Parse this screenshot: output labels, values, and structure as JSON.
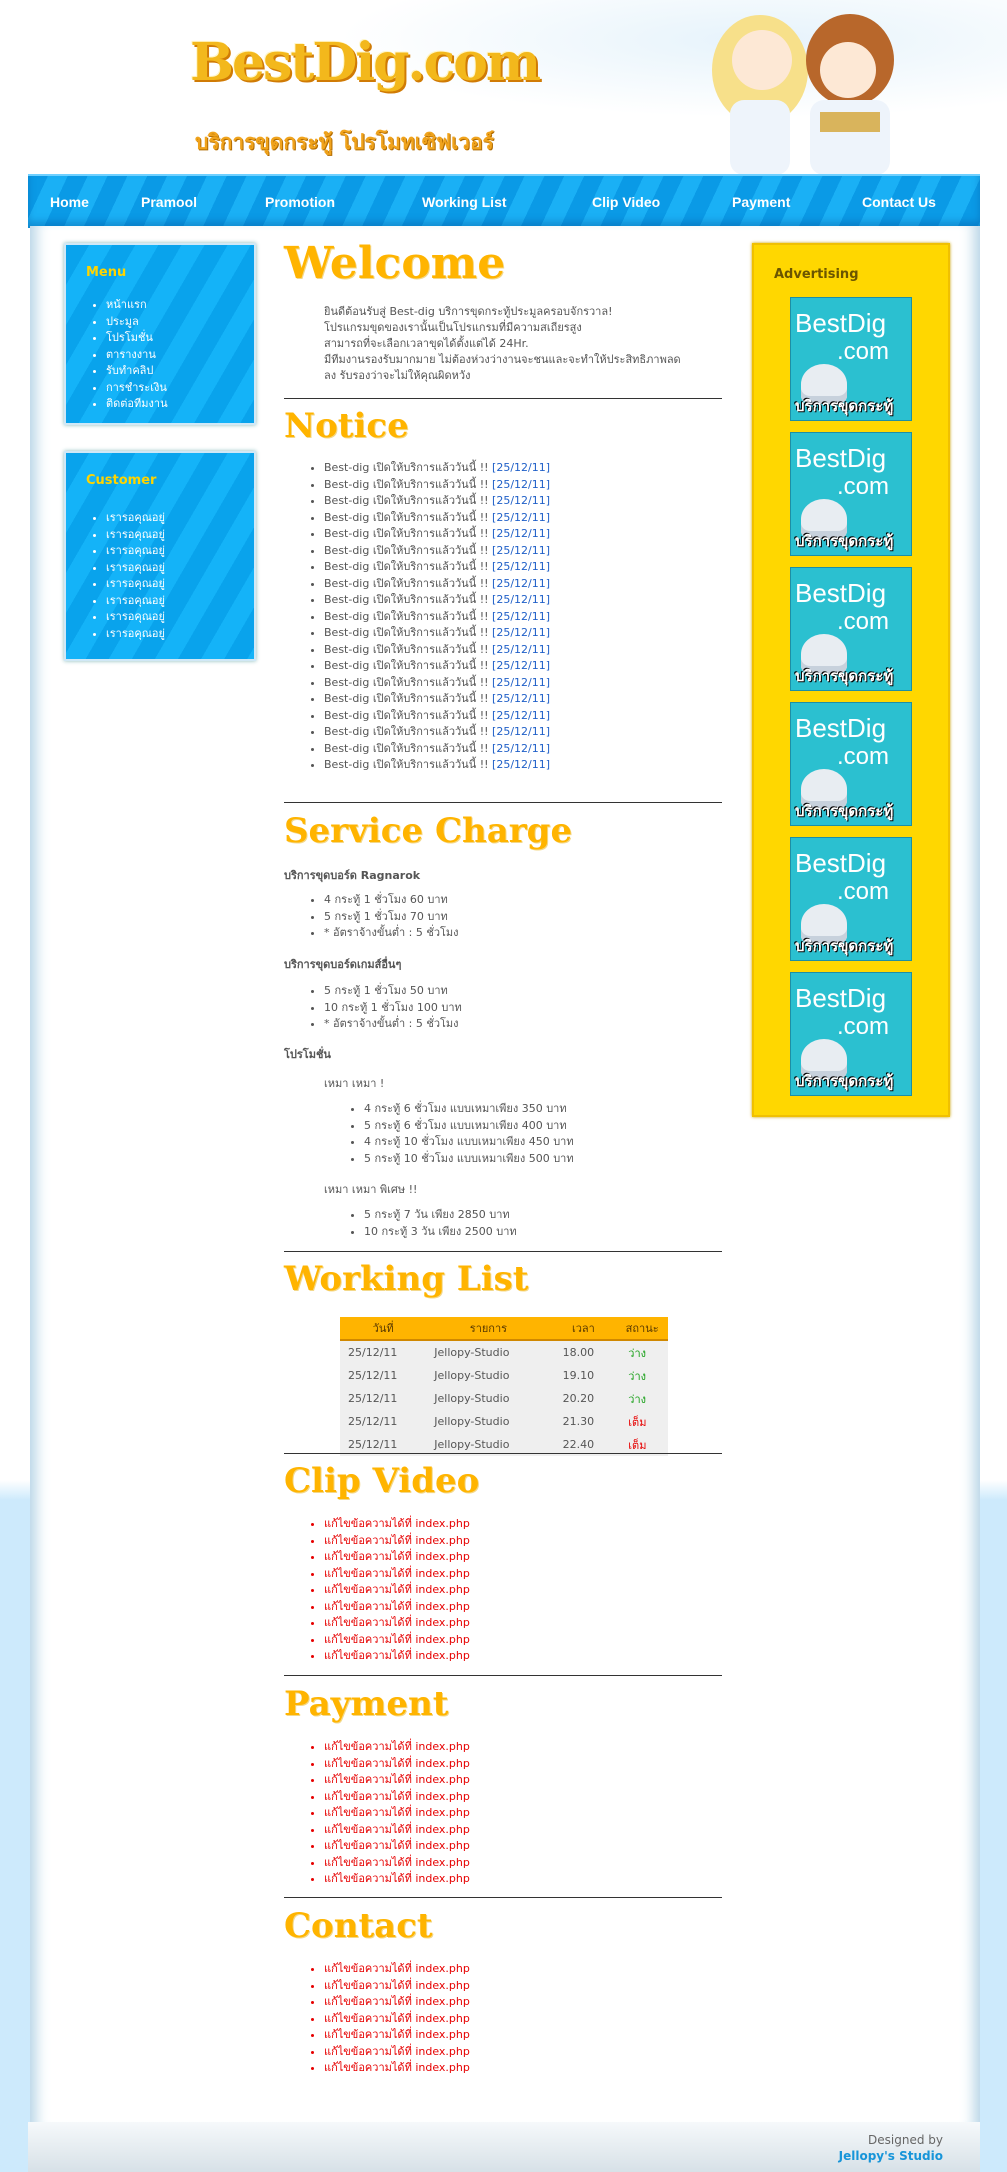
{
  "header": {
    "logo": "BestDig.com",
    "tagline": "บริการขุดกระทู้ โปรโมทเซิฟเวอร์"
  },
  "nav": [
    "Home",
    "Pramool",
    "Promotion",
    "Working List",
    "Clip Video",
    "Payment",
    "Contact Us"
  ],
  "menu": {
    "title": "Menu",
    "items": [
      "หน้าแรก",
      "ประมูล",
      "โปรโมชั่น",
      "ตารางงาน",
      "รับทำคลิป",
      "การชำระเงิน",
      "ติดต่อทีมงาน"
    ]
  },
  "customer": {
    "title": "Customer",
    "items": [
      "เรารอคุณอยู่",
      "เรารอคุณอยู่",
      "เรารอคุณอยู่",
      "เรารอคุณอยู่",
      "เรารอคุณอยู่",
      "เรารอคุณอยู่",
      "เรารอคุณอยู่",
      "เรารอคุณอยู่"
    ]
  },
  "welcome": {
    "title": "Welcome",
    "lines": [
      "ยินดีต้อนรับสู่ Best-dig บริการขุดกระทู้ประมูลครอบจักรวาล!",
      "โปรแกรมขุดของเรานั้นเป็นโปรแกรมที่มีความสเถียรสูง",
      "สามารถที่จะเลือกเวลาขุดได้ตั้งแต่ได้ 24Hr.",
      "มีทีมงานรองรับมากมาย ไม่ต้องห่วงว่างานจะชนและจะทำให้ประสิทธิภาพลด",
      "ลง รับรองว่าจะไม่ให้คุณผิดหวัง"
    ]
  },
  "notice": {
    "title": "Notice",
    "item_text": "Best-dig เปิดให้บริการแล้ววันนี้ !!",
    "item_date": "[25/12/11]",
    "count_label": "19"
  },
  "service": {
    "title": "Service Charge",
    "ragnarok_title": "บริการขุดบอร์ด Ragnarok",
    "ragnarok_items": [
      "4 กระทู้ 1 ชั่วโมง 60 บาท",
      "5 กระทู้ 1 ชั่วโมง 70 บาท"
    ],
    "ragnarok_note": "* อัตราจ้างขั้นต่ำ : 5 ชั่วโมง",
    "other_title": "บริการขุดบอร์ดเกมส์อื่นๆ",
    "other_items": [
      "5 กระทู้ 1 ชั่วโมง 50 บาท",
      "10 กระทู้ 1 ชั่วโมง 100 บาท"
    ],
    "other_note": "* อัตราจ้างขั้นต่ำ : 5 ชั่วโมง",
    "promo_title": "โปรโมชั่น",
    "promo1_title": "เหมา เหมา !",
    "promo1_items": [
      "4 กระทู้ 6 ชั่วโมง แบบเหมาเพียง 350 บาท",
      "5 กระทู้ 6 ชั่วโมง แบบเหมาเพียง 400 บาท",
      "4 กระทู้ 10 ชั่วโมง แบบเหมาเพียง 450 บาท",
      "5 กระทู้ 10 ชั่วโมง แบบเหมาเพียง 500 บาท"
    ],
    "promo2_title": "เหมา เหมา พิเศษ !!",
    "promo2_items": [
      "5 กระทู้ 7 วัน เพียง 2850 บาท",
      "10 กระทู้ 3 วัน เพียง 2500 บาท"
    ]
  },
  "working": {
    "title": "Working List",
    "headers": [
      "วันที่",
      "รายการ",
      "เวลา",
      "สถานะ"
    ],
    "rows": [
      [
        "25/12/11",
        "Jellopy-Studio",
        "18.00",
        "ว่าง"
      ],
      [
        "25/12/11",
        "Jellopy-Studio",
        "19.10",
        "ว่าง"
      ],
      [
        "25/12/11",
        "Jellopy-Studio",
        "20.20",
        "ว่าง"
      ],
      [
        "25/12/11",
        "Jellopy-Studio",
        "21.30",
        "เต็ม"
      ],
      [
        "25/12/11",
        "Jellopy-Studio",
        "22.40",
        "เต็ม"
      ]
    ],
    "status_colors": {
      "ว่าง": "#19a019",
      "เต็ม": "#e60000"
    }
  },
  "clip": {
    "title": "Clip Video",
    "item": "แก้ไขข้อความได้ที่ index.php"
  },
  "payment": {
    "title": "Payment",
    "item": "แก้ไขข้อความได้ที่ index.php"
  },
  "contact": {
    "title": "Contact",
    "item": "แก้ไขข้อความได้ที่ index.php"
  },
  "ads": {
    "title": "Advertising",
    "banner_line1": "BestDig",
    "banner_line2": ".com",
    "banner_line3": "บริการขุดกระทู้"
  },
  "footer": {
    "designed_by": "Designed by",
    "studio": "Jellopy's Studio"
  },
  "colors": {
    "accent": "#ffb400",
    "nav": "#0aa3ec",
    "link": "#2060c8",
    "alert": "#e60000"
  }
}
